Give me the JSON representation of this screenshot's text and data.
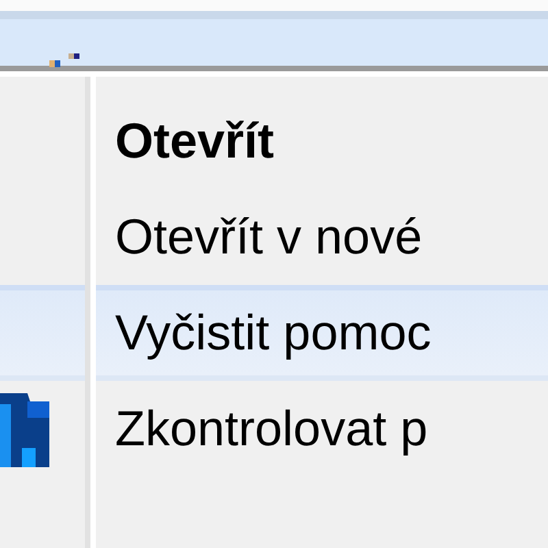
{
  "menu": {
    "items": [
      {
        "label": "Otevřít",
        "kind": "default",
        "selected": false
      },
      {
        "label": "Otevřít v nové",
        "kind": "plain",
        "selected": false
      },
      {
        "label": "Vyčistit pomoc",
        "kind": "plain",
        "selected": true
      },
      {
        "label": "Zkontrolovat p",
        "kind": "icon",
        "selected": false
      }
    ]
  }
}
